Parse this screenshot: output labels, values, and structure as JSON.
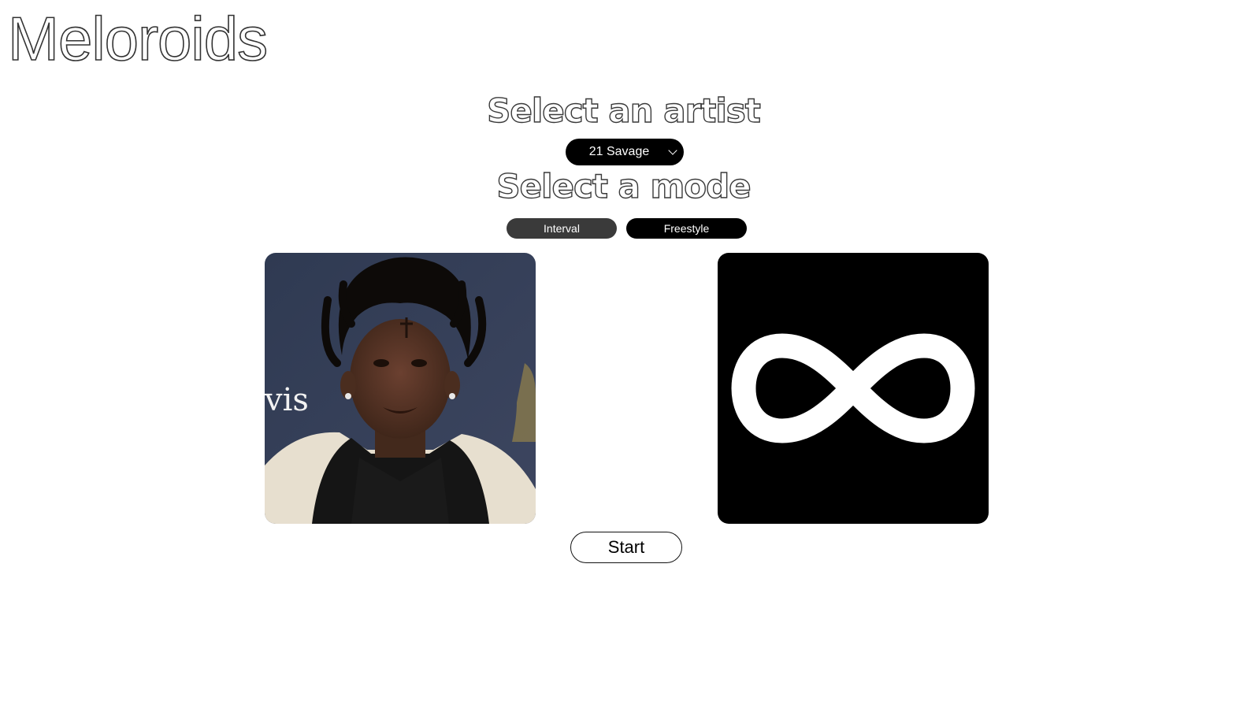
{
  "app": {
    "title": "Meloroids"
  },
  "artist_section": {
    "heading": "Select an artist",
    "select": {
      "selected": "21 Savage"
    }
  },
  "mode_section": {
    "heading": "Select a mode",
    "modes": [
      {
        "label": "Interval",
        "color": "#3a3a3a"
      },
      {
        "label": "Freestyle",
        "color": "#000000"
      }
    ]
  },
  "cards": {
    "artist_photo_text": "vis",
    "mode_icon": "infinity-icon"
  },
  "start_button": {
    "label": "Start"
  }
}
